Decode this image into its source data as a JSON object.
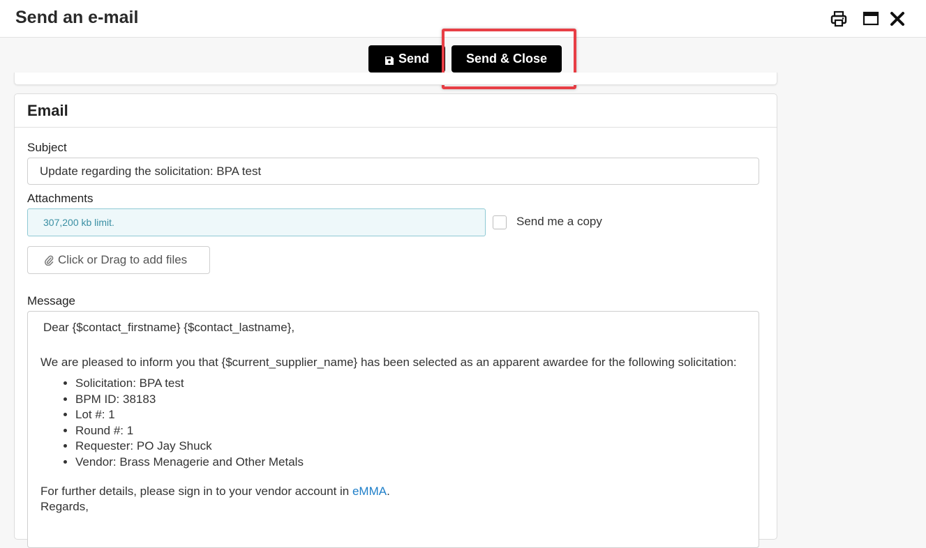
{
  "window": {
    "title": "Send an e-mail",
    "icons": [
      "printer-icon",
      "maximize-icon",
      "close-icon"
    ]
  },
  "toolbar": {
    "send_label": "Send",
    "send_close_label": "Send & Close",
    "highlight_color": "#e83e45"
  },
  "email": {
    "section_title": "Email",
    "subject_label": "Subject",
    "subject_value": "Update regarding the solicitation: BPA test",
    "attachments_label": "Attachments",
    "attachments_limit": "307,200 kb limit.",
    "send_copy_label": "Send me a copy",
    "add_files_label": "Click or Drag to add files",
    "message_label": "Message",
    "message": {
      "greeting": "Dear {$contact_firstname} {$contact_lastname},",
      "intro": "We are pleased to inform you that {$current_supplier_name} has been selected as an apparent awardee for the following solicitation:",
      "items": [
        "Solicitation: BPA test",
        "BPM ID: 38183",
        "Lot #: 1",
        "Round #: 1",
        "Requester: PO Jay Shuck",
        "Vendor: Brass Menagerie and Other Metals"
      ],
      "details_prefix": "For further details, please sign in to your vendor account in ",
      "details_link": "eMMA",
      "details_suffix": ".",
      "closing": "Regards,"
    }
  },
  "colors": {
    "button_bg": "#000000",
    "link": "#1f7fc9",
    "attach_border": "#8fc9d4",
    "attach_bg": "#eef8fa"
  }
}
